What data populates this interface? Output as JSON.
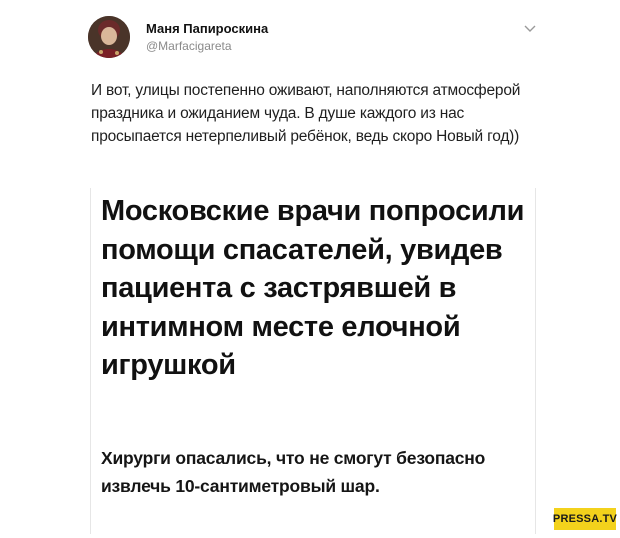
{
  "tweet": {
    "author_name": "Маня Папироскина",
    "author_handle": "@Marfacigareta",
    "text": "И вот, улицы постепенно оживают, наполняются атмосферой праздника и ожиданием чуда. В душе каждого из нас просыпается нетерпеливый ребёнок, ведь скоро Новый год))"
  },
  "article": {
    "headline": "Московские врачи попросили помощи спасателей, увидев пациента с застрявшей в интимном месте елочной игрушкой",
    "lead": "Хирурги опасались, что не смогут безопасно извлечь 10-сантиметровый шар."
  },
  "watermark": {
    "label": "PRESSA.TV",
    "color": "#f3d21c"
  },
  "icons": {
    "menu": "chevron-down-icon",
    "avatar": "avatar"
  }
}
